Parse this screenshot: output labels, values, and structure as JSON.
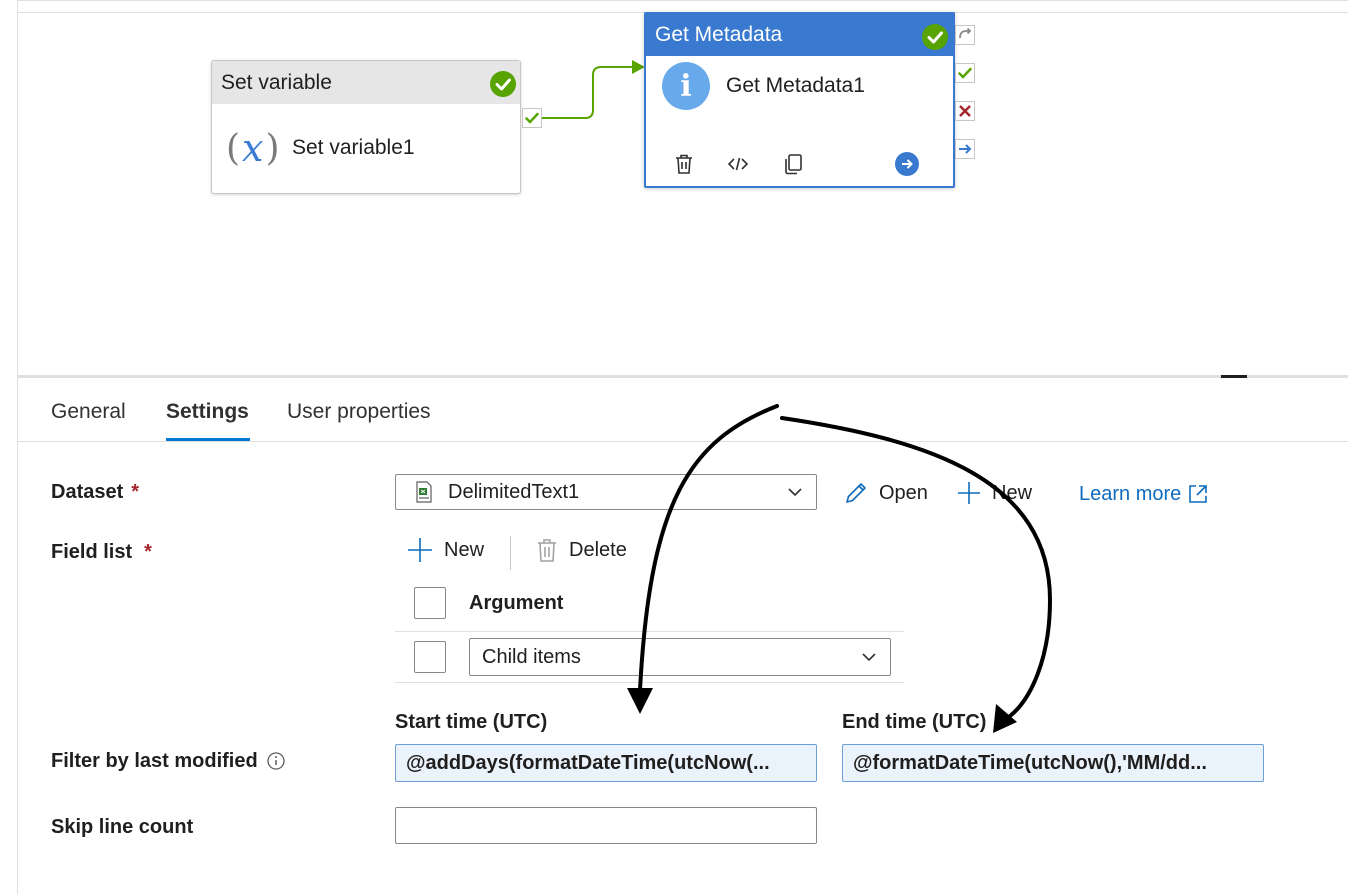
{
  "canvas": {
    "set_variable": {
      "header": "Set variable",
      "name": "Set variable1",
      "icon": "variable-fx-icon"
    },
    "get_metadata": {
      "header": "Get Metadata",
      "name": "Get Metadata1",
      "icon": "info-icon"
    },
    "colors": {
      "selected": "#3979d0",
      "success": "#57a300",
      "failure": "#a4262c"
    }
  },
  "tabs": [
    {
      "label": "General"
    },
    {
      "label": "Settings",
      "active": true
    },
    {
      "label": "User properties"
    }
  ],
  "form": {
    "dataset": {
      "label": "Dataset",
      "required": "*",
      "value": "DelimitedText1",
      "open_label": "Open",
      "new_label": "New",
      "learn_more_label": "Learn more"
    },
    "field_list": {
      "label": "Field list",
      "required": "*",
      "new_label": "New",
      "delete_label": "Delete",
      "column_header": "Argument",
      "rows": [
        {
          "value": "Child items"
        }
      ]
    },
    "filter": {
      "label": "Filter by last modified",
      "start_label": "Start time (UTC)",
      "start_value": "@addDays(formatDateTime(utcNow(...",
      "end_label": "End time (UTC)",
      "end_value": "@formatDateTime(utcNow(),'MM/dd..."
    },
    "skip_line_count": {
      "label": "Skip line count",
      "value": ""
    }
  }
}
